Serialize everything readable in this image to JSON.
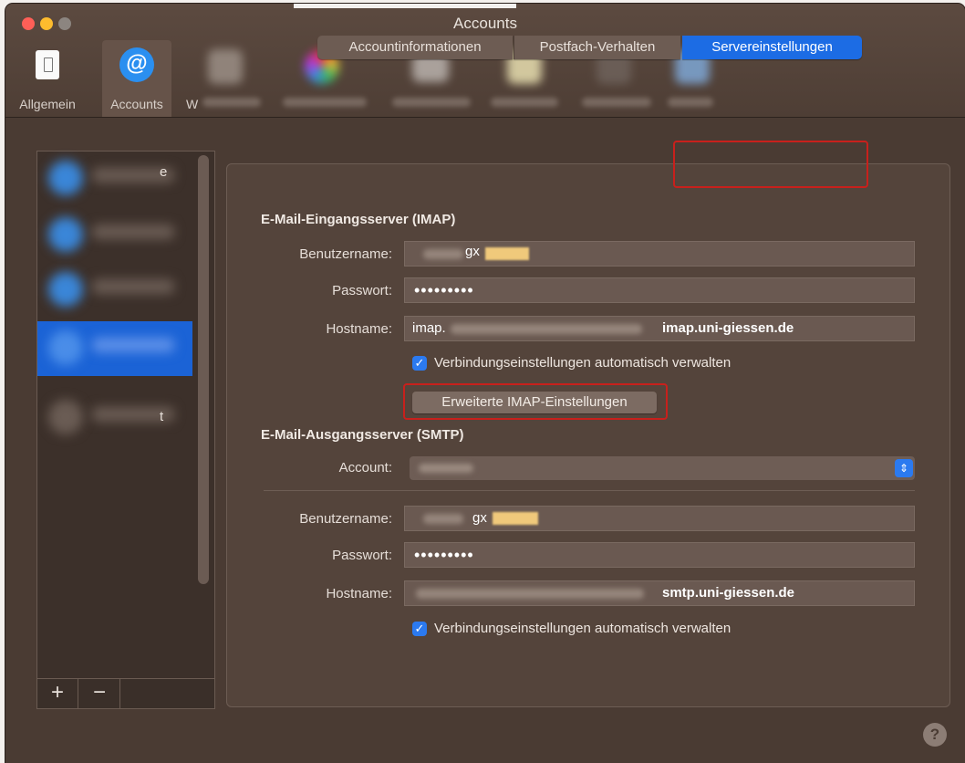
{
  "window": {
    "title": "Accounts"
  },
  "toolbar": {
    "general_label": "Allgemein",
    "accounts_label": "Accounts",
    "cut_label": "W"
  },
  "account_list": {
    "edge_letter_1": "e",
    "edge_letter_2": "t",
    "add_label": "+",
    "remove_label": "−"
  },
  "tabs": {
    "account_info": "Accountinformationen",
    "mailbox_behavior": "Postfach-Verhalten",
    "server_settings": "Servereinstellungen"
  },
  "incoming": {
    "title": "E-Mail-Eingangsserver (IMAP)",
    "username_label": "Benutzername:",
    "username_value": "gx",
    "password_label": "Passwort:",
    "password_value": "•••••••••",
    "hostname_label": "Hostname:",
    "hostname_prefix": "imap.",
    "hostname_annotation": "imap.uni-giessen.de",
    "auto_manage_label": "Verbindungseinstellungen automatisch verwalten",
    "advanced_button": "Erweiterte IMAP-Einstellungen"
  },
  "outgoing": {
    "title": "E-Mail-Ausgangsserver (SMTP)",
    "account_label": "Account:",
    "username_label": "Benutzername:",
    "username_value": "gx",
    "password_label": "Passwort:",
    "password_value": "•••••••••",
    "hostname_label": "Hostname:",
    "hostname_annotation": "smtp.uni-giessen.de",
    "auto_manage_label": "Verbindungseinstellungen automatisch verwalten"
  },
  "help_label": "?",
  "colors": {
    "window_bg": "#4a3b33",
    "accent_blue": "#1c6ce4",
    "highlight_red": "#c8201c",
    "annotation_yellow": "#f0c97b"
  },
  "icons": {
    "general": "general-preferences-icon",
    "accounts": "at-sign-icon",
    "checkbox": "checkmark-icon",
    "select": "stepper-arrows-icon",
    "help": "help-icon"
  }
}
